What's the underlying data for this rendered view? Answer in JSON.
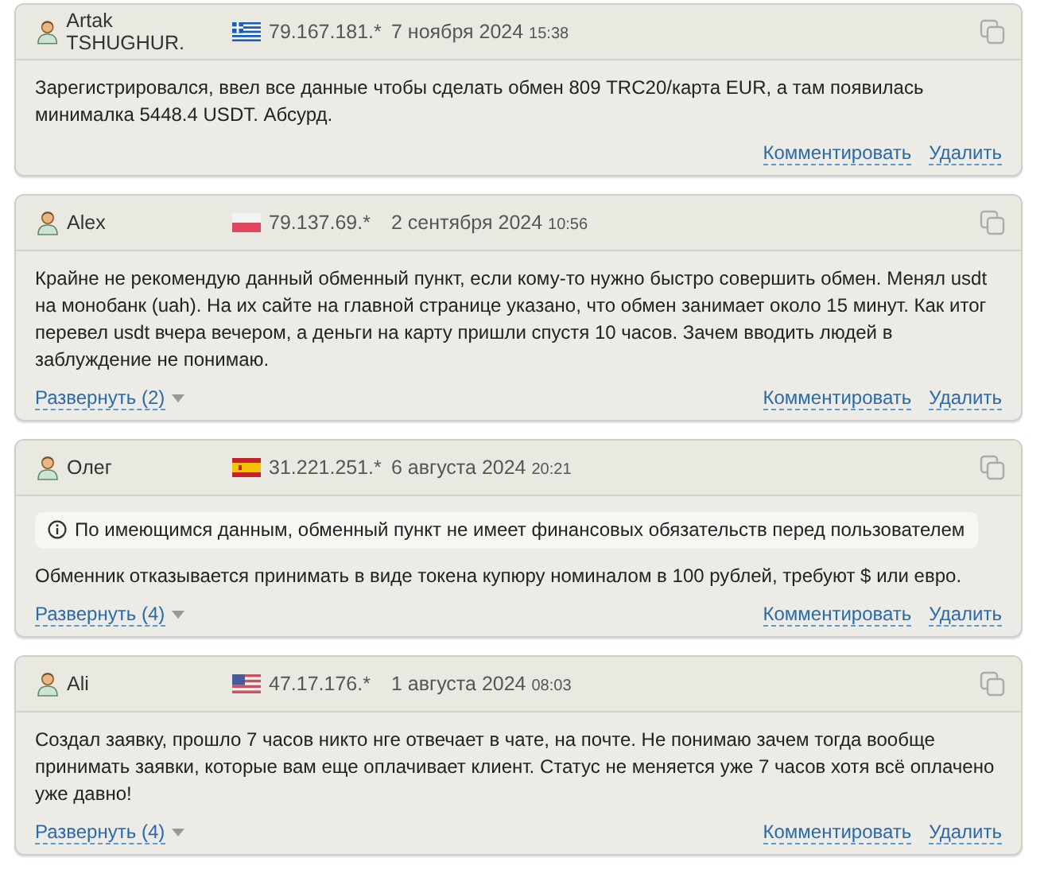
{
  "comments": [
    {
      "author": "Artak TSHUGHUR.",
      "kind": "gr",
      "ip": "79.167.181.*",
      "date": "7 ноября 2024",
      "time": "15:38",
      "text": "Зарегистрировался, ввел все данные чтобы сделать обмен 809 TRC20/карта EUR, а там появилась минималка 5448.4 USDT. Абсурд.",
      "comment_link": "Комментировать",
      "delete_link": "Удалить"
    },
    {
      "author": "Alex",
      "kind": "pl",
      "ip": "79.137.69.*",
      "date": "2 сентября 2024",
      "time": "10:56",
      "text": "Крайне не рекомендую данный обменный пункт, если кому-то нужно быстро совершить обмен. Менял usdt на монобанк (uah). На их сайте на главной странице указано, что обмен занимает около 15 минут. Как итог перевел usdt вчера вечером, а деньги на карту пришли спустя 10 часов. Зачем вводить людей в заблуждение не понимаю.",
      "expand": "Развернуть (2)",
      "comment_link": "Комментировать",
      "delete_link": "Удалить"
    },
    {
      "author": "Олег",
      "kind": "es",
      "ip": "31.221.251.*",
      "date": "6 августа 2024",
      "time": "20:21",
      "notice": "По имеющимся данным, обменный пункт не имеет финансовых обязательств перед пользователем",
      "text": "Обменник отказывается принимать в виде токена купюру номиналом в 100 рублей, требуют $ или евро.",
      "expand": "Развернуть (4)",
      "comment_link": "Комментировать",
      "delete_link": "Удалить"
    },
    {
      "author": "Ali",
      "kind": "us",
      "ip": "47.17.176.*",
      "date": "1 августа 2024",
      "time": "08:03",
      "text": "Создал заявку, прошло 7 часов никто нге отвечает в чате, на почте. Не понимаю зачем тогда вообще принимать заявки, которые вам еще оплачивает клиент. Статус не меняется уже 7 часов хотя всё оплачено уже давно!",
      "expand": "Развернуть (4)",
      "comment_link": "Комментировать",
      "delete_link": "Удалить"
    }
  ]
}
